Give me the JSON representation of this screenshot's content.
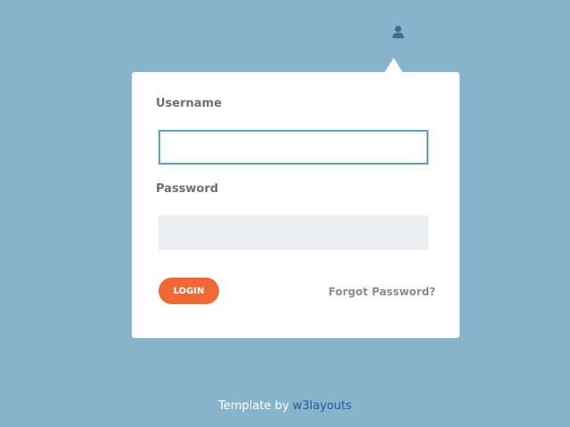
{
  "header": {
    "user_icon": "user-icon"
  },
  "login_form": {
    "username_label": "Username",
    "username_value": "",
    "password_label": "Password",
    "password_value": "",
    "login_button": "LOGIN",
    "forgot_link": "Forgot Password?"
  },
  "footer": {
    "prefix": "Template by ",
    "link_text": "w3layouts"
  },
  "colors": {
    "background": "#88b3cc",
    "accent": "#ef6a35",
    "input_focus_border": "#5b9fc2",
    "link": "#1f5f9a"
  }
}
